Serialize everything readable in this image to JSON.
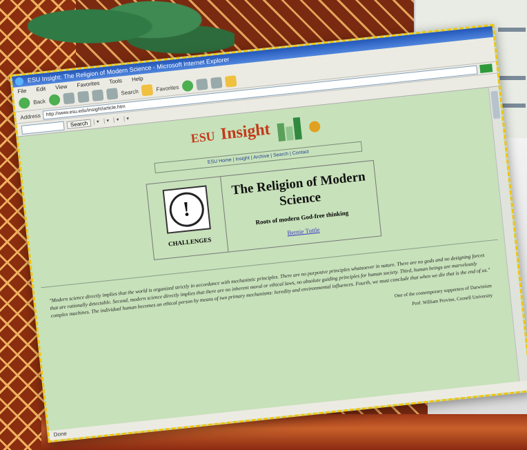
{
  "browser": {
    "title": "ESU Insight: The Religion of Modern Science - Microsoft Internet Explorer",
    "menu": [
      "File",
      "Edit",
      "View",
      "Favorites",
      "Tools",
      "Help"
    ],
    "toolbar": {
      "back_label": "Back",
      "search_label": "Search",
      "favorites_label": "Favorites"
    },
    "address_label": "Address",
    "address_value": "http://www.esu.edu/insight/article.htm",
    "search_box": {
      "button_label": "Search"
    },
    "status_text": "Done"
  },
  "page": {
    "logo_esu": "ESU",
    "logo_insight": "Insight",
    "nav_links": "ESU Home | Insight | Archive | Search | Contact",
    "challenge_label": "CHALLENGES",
    "challenge_icon_glyph": "!",
    "title": "The Religion of Modern Science",
    "subtitle": "Roots of modern God-free thinking",
    "author_link": "Bernie Tuttle",
    "quote": "\"Modern science directly implies that the world is organized strictly in accordance with mechanistic principles. There are no purposive principles whatsoever in nature. There are no gods and no designing forces that are rationally detectable. Second, modern science directly implies that there are no inherent moral or ethical laws, no absolute guiding principles for human society. Third, human beings are marvelously complex machines. The individual human becomes an ethical person by means of two primary mechanisms: heredity and environmental influences. Fourth, we must conclude that when we die that is the end of us.\"",
    "quote_source": "One of the contemporary supporters of Darwinism",
    "quote_author": "Prof. William Provine, Cornell University"
  }
}
